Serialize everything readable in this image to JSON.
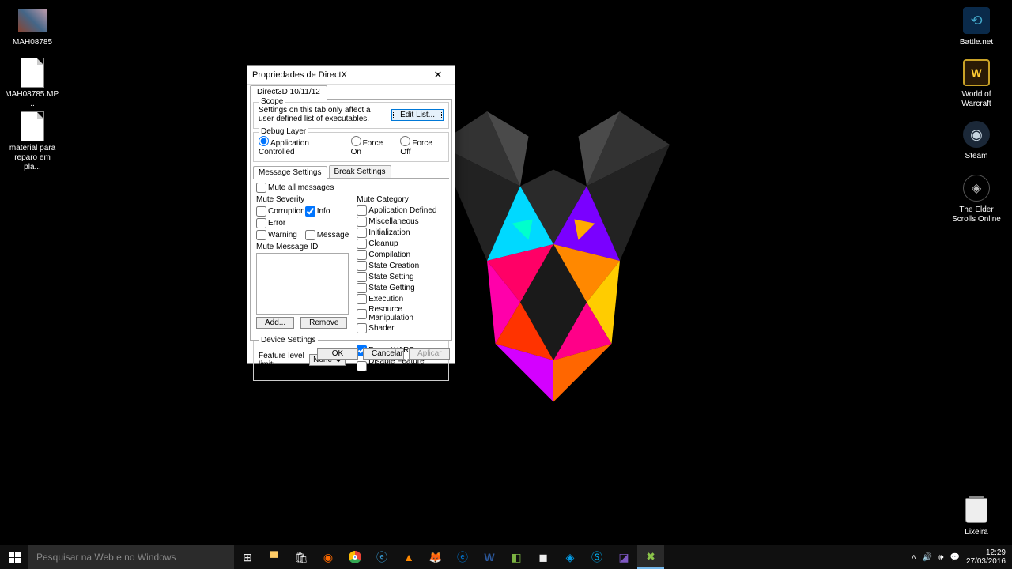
{
  "desktop": {
    "icons_left": [
      {
        "label": "MAH08785"
      },
      {
        "label": "MAH08785.MP..."
      },
      {
        "label": "material para reparo em pla..."
      }
    ],
    "icons_right": [
      {
        "label": "Battle.net"
      },
      {
        "label": "World of Warcraft"
      },
      {
        "label": "Steam"
      },
      {
        "label": "The Elder Scrolls Online"
      }
    ],
    "recyclebin": "Lixeira"
  },
  "dialog": {
    "title": "Propriedades de DirectX",
    "tab": "Direct3D 10/11/12",
    "scope": {
      "legend": "Scope",
      "text": "Settings on this tab only affect a user defined list of executables.",
      "button": "Edit List..."
    },
    "debug": {
      "legend": "Debug Layer",
      "opt1": "Application Controlled",
      "opt2": "Force On",
      "opt3": "Force Off"
    },
    "subtabs": {
      "t1": "Message Settings",
      "t2": "Break Settings"
    },
    "msg": {
      "mute_all": "Mute all messages",
      "severity_h": "Mute Severity",
      "sev": [
        "Corruption",
        "Info",
        "Error",
        "Warning",
        "Message"
      ],
      "muteid_h": "Mute Message ID",
      "add": "Add...",
      "remove": "Remove",
      "cat_h": "Mute Category",
      "cats": [
        "Application Defined",
        "Miscellaneous",
        "Initialization",
        "Cleanup",
        "Compilation",
        "State Creation",
        "State Setting",
        "State Getting",
        "Execution",
        "Resource Manipulation",
        "Shader"
      ]
    },
    "device": {
      "legend": "Device Settings",
      "feature_label": "Feature level limit:",
      "feature_value": "None",
      "cb1": "Force WARP",
      "cb2": "Disable Feature Level Upgrade"
    },
    "buttons": {
      "ok": "OK",
      "cancel": "Cancelar",
      "apply": "Aplicar"
    }
  },
  "taskbar": {
    "search_placeholder": "Pesquisar na Web e no Windows",
    "time": "12:29",
    "date": "27/03/2016"
  }
}
